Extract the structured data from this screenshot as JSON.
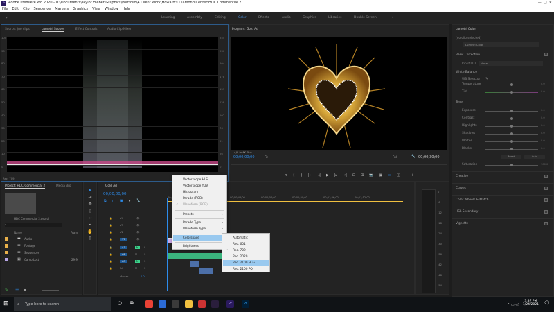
{
  "window": {
    "title": "Adobe Premiere Pro 2020 - D:\\Documents\\Taylor Hieber Graphics\\Portfolio\\4 Client Work\\Howard's Diamond Center\\HDC Commercial 2",
    "app_icon": "Pr"
  },
  "menu": [
    "File",
    "Edit",
    "Clip",
    "Sequence",
    "Markers",
    "Graphics",
    "View",
    "Window",
    "Help"
  ],
  "workspaces": {
    "items": [
      "Learning",
      "Assembly",
      "Editing",
      "Color",
      "Effects",
      "Audio",
      "Graphics",
      "Libraries",
      "Double Screen"
    ],
    "active": "Color",
    "more": "»"
  },
  "source_panel": {
    "tabs": [
      "Source: (no clips)",
      "Lumetri Scopes",
      "Effect Controls",
      "Audio Clip Mixer"
    ],
    "active_tab": "Lumetri Scopes",
    "left_axis": [
      "100",
      "90",
      "80",
      "70",
      "60",
      "50",
      "40",
      "30",
      "20",
      "10",
      "0"
    ],
    "right_axis": [
      "255",
      "230",
      "204",
      "178",
      "153",
      "128",
      "102",
      "76",
      "51",
      "26",
      "0"
    ],
    "colorspace_label": "Rec. 709"
  },
  "program": {
    "title": "Program: Gold Ad",
    "overlay": "AJA Io 4K Plus",
    "timecode": "00;00;00;00",
    "fit": "Fit",
    "quality": "Full",
    "duration": "00;00;30;00",
    "accent": "#2d8ceb"
  },
  "context_menu": {
    "items": [
      {
        "label": "Vectorscope HLS"
      },
      {
        "label": "Vectorscope YUV"
      },
      {
        "label": "Histogram"
      },
      {
        "label": "Parade (RGB)"
      },
      {
        "label": "Waveform (RGB)",
        "checked": true,
        "disabled": true
      },
      {
        "label": "Presets",
        "submenu": true
      },
      {
        "label": "Parade Type",
        "submenu": true
      },
      {
        "label": "Waveform Type",
        "submenu": true
      },
      {
        "label": "Colorspace",
        "submenu": true,
        "highlighted": true
      },
      {
        "label": "Brightness",
        "submenu": true
      }
    ],
    "submenu": [
      {
        "label": "Automatic"
      },
      {
        "label": "Rec. 601"
      },
      {
        "label": "Rec. 709",
        "selected": true
      },
      {
        "label": "Rec. 2020"
      },
      {
        "label": "Rec. 2100 HLG",
        "highlighted": true
      },
      {
        "label": "Rec. 2100 PQ"
      }
    ]
  },
  "lumetri": {
    "title": "Lumetri Color",
    "clip": "(no clip selected)",
    "preset": "Lumetri Color",
    "basic": "Basic Correction",
    "input_lut_label": "Input LUT",
    "input_lut": "None",
    "white_balance": "White Balance",
    "wb_selector": "WB Selector",
    "wb_sliders": [
      {
        "label": "Temperature",
        "value": "0.0"
      },
      {
        "label": "Tint",
        "value": "0.0"
      }
    ],
    "tone": "Tone",
    "tone_sliders": [
      {
        "label": "Exposure",
        "value": "0.0"
      },
      {
        "label": "Contrast",
        "value": "0.0"
      },
      {
        "label": "Highlights",
        "value": "0.0"
      },
      {
        "label": "Shadows",
        "value": "0.0"
      },
      {
        "label": "Whites",
        "value": "0.0"
      },
      {
        "label": "Blacks",
        "value": "0.0"
      }
    ],
    "reset": "Reset",
    "auto": "Auto",
    "saturation": {
      "label": "Saturation",
      "value": "100.0"
    },
    "sections": [
      "Creative",
      "Curves",
      "Color Wheels & Match",
      "HSL Secondary",
      "Vignette"
    ]
  },
  "project": {
    "tabs": [
      "Project: HDC Commercial 2",
      "Media Bro"
    ],
    "file": "HDC Commercial 2.prproj",
    "col_name": "Name",
    "col_frame": "Fram",
    "items": [
      {
        "name": "Audio",
        "type": "bin",
        "color": "#e8b04a"
      },
      {
        "name": "Footage",
        "type": "bin",
        "color": "#e8b04a"
      },
      {
        "name": "Sequences",
        "type": "bin",
        "color": "#e8b04a"
      },
      {
        "name": "Camp Lost",
        "type": "sequence",
        "color": "#b7a5e6",
        "fps": "29.9"
      }
    ]
  },
  "timeline": {
    "title": "Gold Ad",
    "timecode": "00;00;00;00",
    "ruler": [
      "00;00",
      "00;00;32;00",
      "00;00;48;00",
      "00;01;04;02",
      "00;01;20;02",
      "00;01;36;02",
      "00;01;52;02"
    ],
    "video_tracks": [
      "V4",
      "V3",
      "V2",
      "V1"
    ],
    "audio_tracks": [
      "A1",
      "A2",
      "A3",
      "A4"
    ],
    "master": "Master",
    "master_value": "0.0"
  },
  "meters": [
    "0",
    "-6",
    "-12",
    "-18",
    "-24",
    "-30",
    "-36",
    "-42",
    "-48",
    "-54"
  ],
  "taskbar": {
    "search": "Type here to search",
    "time": "3:37 PM",
    "date": "1/24/2021"
  }
}
